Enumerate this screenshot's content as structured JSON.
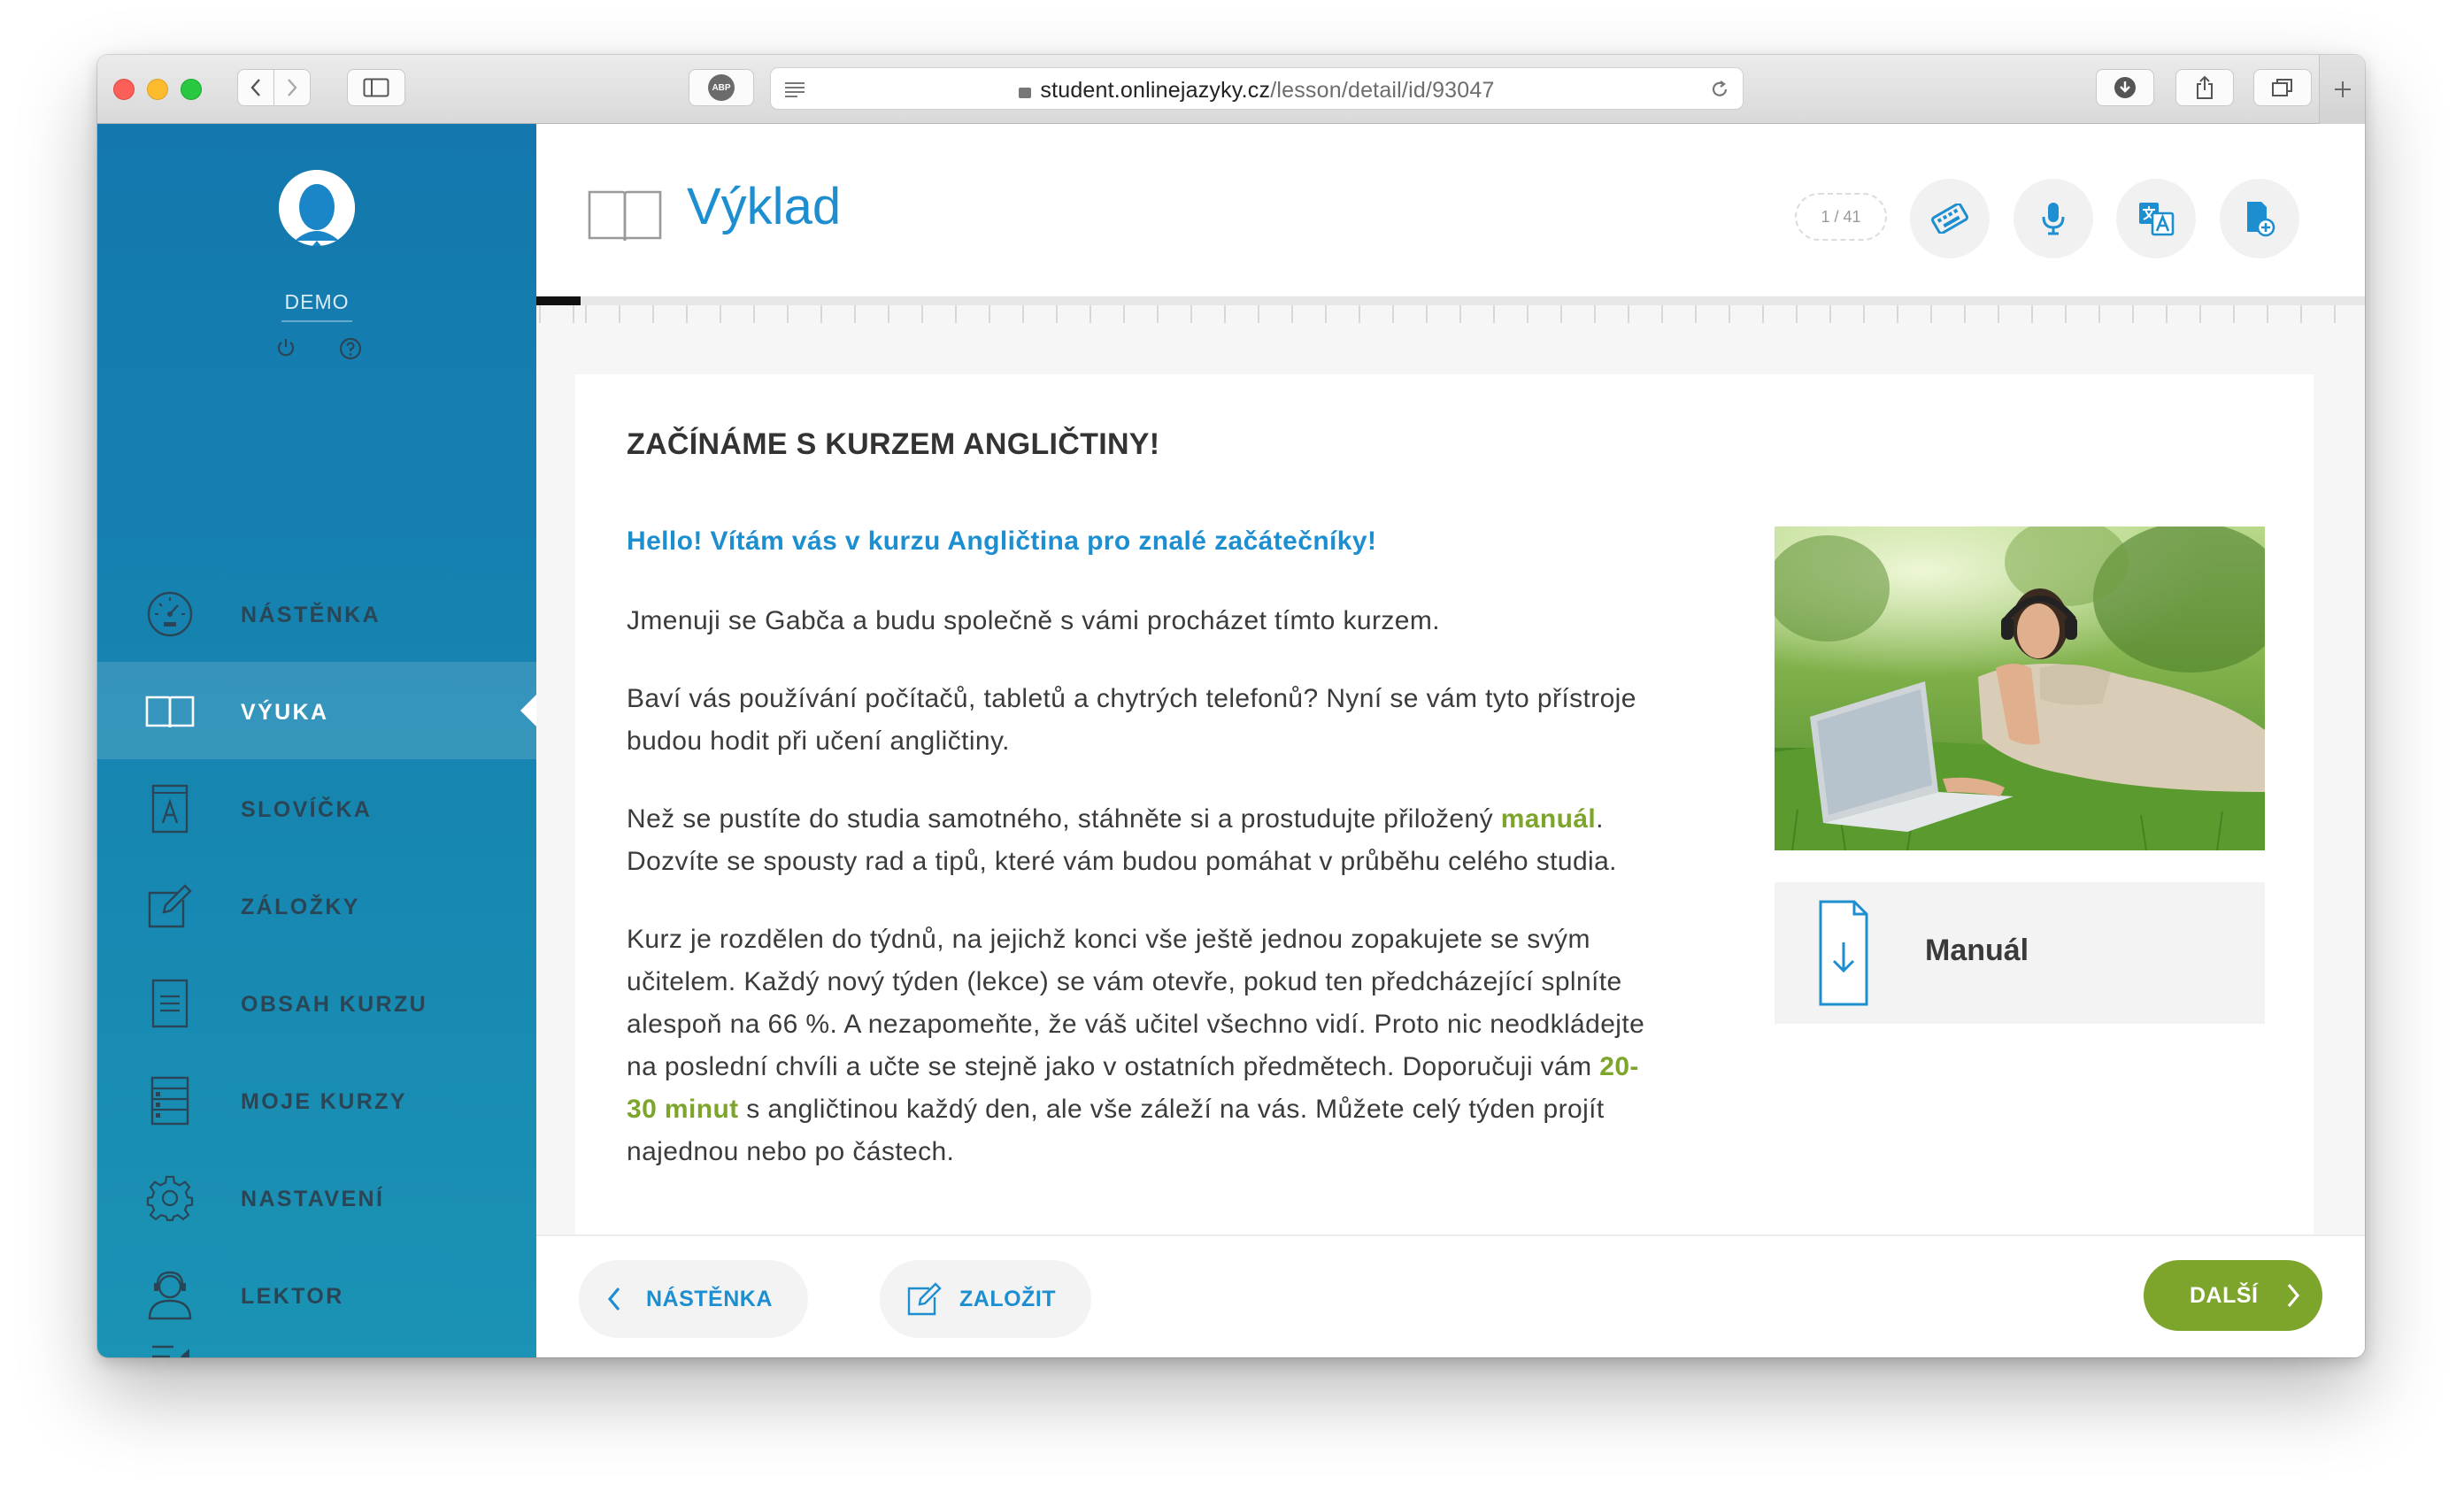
{
  "browser": {
    "url_domain": "student.onlinejazyky.cz",
    "url_path": "/lesson/detail/id/93047",
    "adblock_label": "ABP"
  },
  "user": {
    "name": "DEMO"
  },
  "sidebar": {
    "items": [
      {
        "label": "NÁSTĚNKA",
        "icon": "dashboard-icon"
      },
      {
        "label": "VÝUKA",
        "icon": "book-icon",
        "active": true
      },
      {
        "label": "SLOVÍČKA",
        "icon": "vocabulary-icon"
      },
      {
        "label": "ZÁLOŽKY",
        "icon": "bookmark-edit-icon"
      },
      {
        "label": "OBSAH KURZU",
        "icon": "document-icon"
      },
      {
        "label": "MOJE KURZY",
        "icon": "course-list-icon"
      },
      {
        "label": "NASTAVENÍ",
        "icon": "gear-icon"
      },
      {
        "label": "LEKTOR",
        "icon": "tutor-icon"
      }
    ]
  },
  "header": {
    "title": "Výklad",
    "counter": "1 / 41",
    "progress_fraction": 0.0244
  },
  "lesson": {
    "heading": "ZAČÍNÁME S KURZEM ANGLIČTINY!",
    "lead": "Hello! Vítám vás v kurzu Angličtina pro znalé začátečníky!",
    "p1": "Jmenuji se Gabča a budu společně s vámi procházet tímto kurzem.",
    "p2": "Baví vás používání počítačů, tabletů a chytrých telefonů? Nyní se vám tyto přístroje budou hodit při učení angličtiny.",
    "p3_before": "Než se pustíte do studia samotného, stáhněte si a prostudujte přiložený ",
    "p3_link": "manuál",
    "p3_after": ". Dozvíte se spousty rad a tipů, které vám budou pomáhat v průběhu celého studia.",
    "p4_before": "Kurz je rozdělen do týdnů, na jejichž konci vše ještě jednou zopakujete se svým učitelem. Každý nový týden (lekce) se vám otevře, pokud ten předcházející splníte alespoň na 66 %. A nezapomeňte, že váš učitel všechno vidí. Proto nic neodkládejte na poslední chvíli a učte se stejně jako v ostatních předmětech. Doporučuji vám ",
    "p4_highlight": "20-30 minut",
    "p4_after": " s angličtinou každý den, ale vše záleží na vás. Můžete celý týden projít najednou nebo po částech.",
    "manual_label": "Manuál"
  },
  "footer": {
    "back_label": "NÁSTĚNKA",
    "bookmark_label": "ZALOŽIT",
    "next_label": "DALŠÍ"
  },
  "colors": {
    "sidebar": "#1478ae",
    "accent_blue": "#1d8fd0",
    "accent_green": "#7ea52b"
  }
}
